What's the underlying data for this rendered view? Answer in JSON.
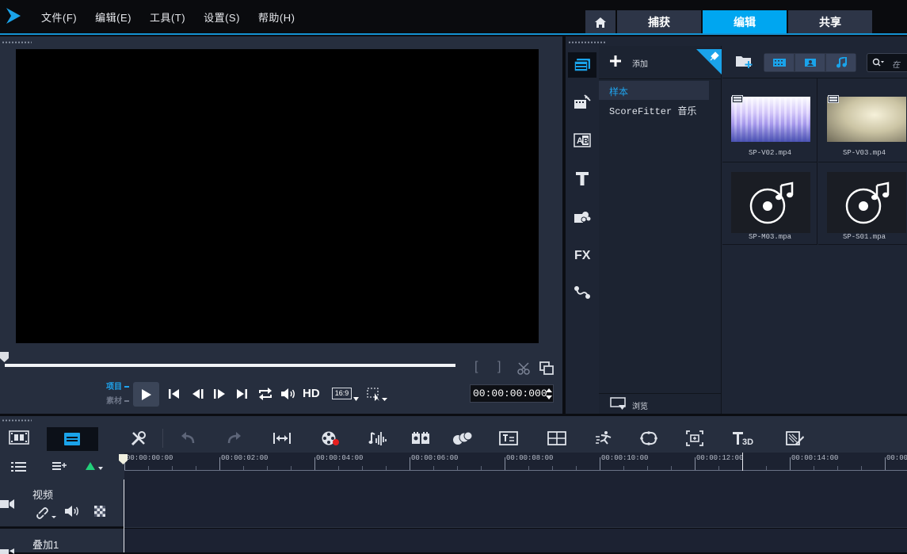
{
  "menu": [
    {
      "label": "文件(F)"
    },
    {
      "label": "编辑(E)"
    },
    {
      "label": "工具(T)"
    },
    {
      "label": "设置(S)"
    },
    {
      "label": "帮助(H)"
    }
  ],
  "tabs": {
    "home_icon": "home-icon",
    "capture": "捕获",
    "edit": "编辑",
    "share": "共享",
    "active": "编辑"
  },
  "player": {
    "mode_project": "项目",
    "mode_clip": "素材",
    "hd_label": "HD",
    "aspect_label": "16:9",
    "timecode": "00:00:00:000",
    "mark_in": "[",
    "mark_out": "]"
  },
  "library": {
    "add_label": "添加",
    "browse_label": "浏览",
    "search_placeholder": "在",
    "folders": [
      "样本",
      "ScoreFitter 音乐"
    ],
    "selected_folder": "样本",
    "items": [
      {
        "name": "SP-V02.mp4",
        "kind": "video"
      },
      {
        "name": "SP-V03.mp4",
        "kind": "video"
      },
      {
        "name": "SP-M03.mpa",
        "kind": "audio"
      },
      {
        "name": "SP-S01.mpa",
        "kind": "audio"
      }
    ]
  },
  "timeline": {
    "ruler_ticks": [
      "00:00:00:00",
      "00:00:02:00",
      "00:00:04:00",
      "00:00:06:00",
      "00:00:08:00",
      "00:00:10:00",
      "00:00:12:00",
      "00:00:14:00",
      "00:00"
    ],
    "tracks": [
      {
        "label": "视频"
      },
      {
        "label": "叠加1"
      }
    ]
  },
  "colors": {
    "accent": "#00a6f0",
    "panel": "#262e3e",
    "background": "#0b0d12"
  }
}
